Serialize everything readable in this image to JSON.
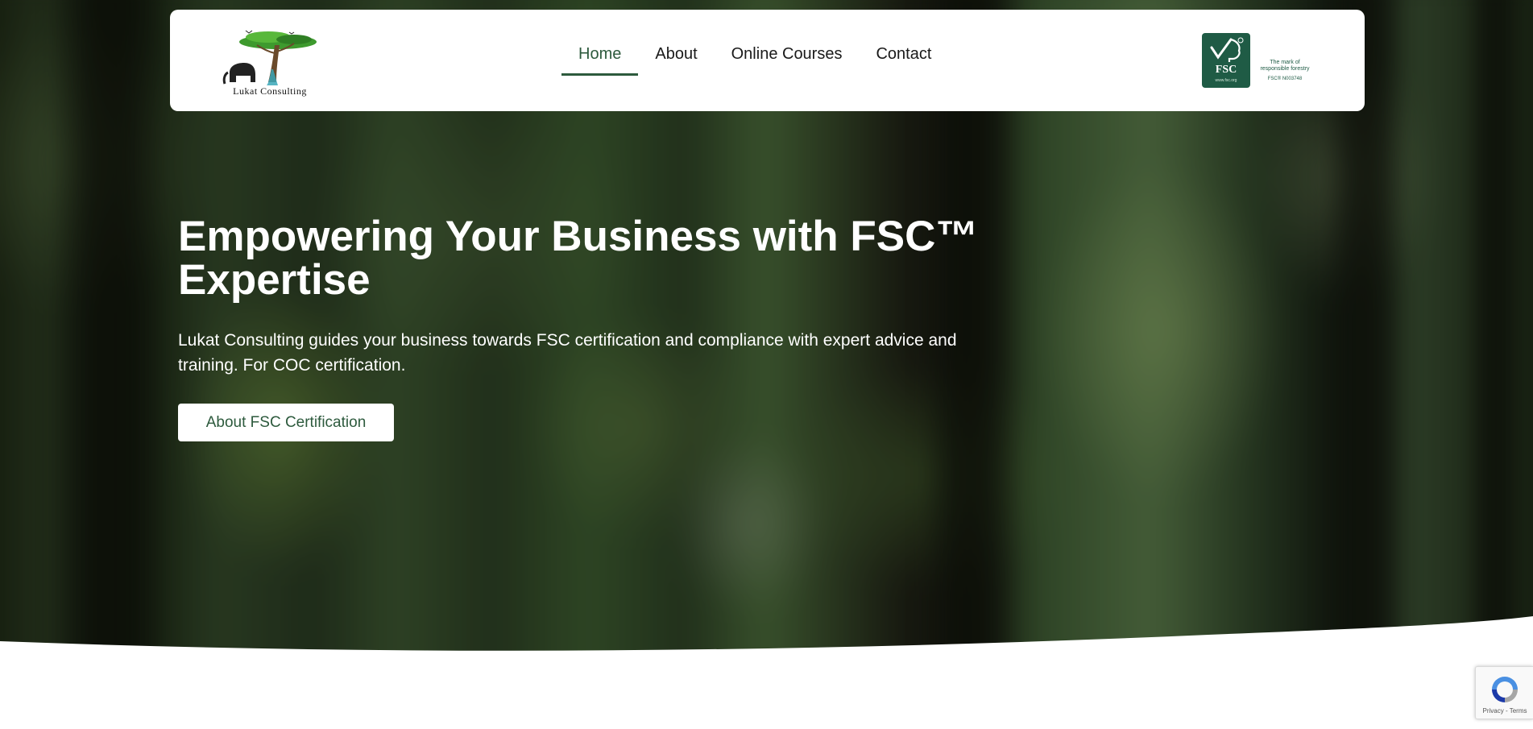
{
  "header": {
    "logo": {
      "icon": "elephant-acacia-tree-logo",
      "text": "Lukat Consulting"
    },
    "nav": {
      "items": [
        {
          "label": "Home",
          "active": true
        },
        {
          "label": "About",
          "active": false
        },
        {
          "label": "Online Courses",
          "active": false
        },
        {
          "label": "Contact",
          "active": false
        }
      ]
    },
    "fsc_badge": {
      "icon": "fsc-tree-checkmark-logo",
      "label": "FSC",
      "site": "www.fsc.org",
      "mark_line1": "The mark of",
      "mark_line2": "responsible forestry",
      "code": "FSC® N003748"
    }
  },
  "hero": {
    "title": "Empowering Your Business with FSC™ Expertise",
    "text": "Lukat Consulting guides your business towards FSC certification and compliance with expert advice and training. For COC certification.",
    "cta_label": "About FSC Certification"
  },
  "recaptcha": {
    "icon": "recaptcha-icon",
    "links": "Privacy - Terms"
  },
  "colors": {
    "brand_green": "#2d5a3d",
    "fsc_green": "#1f5b45",
    "hero_text": "#ffffff"
  }
}
